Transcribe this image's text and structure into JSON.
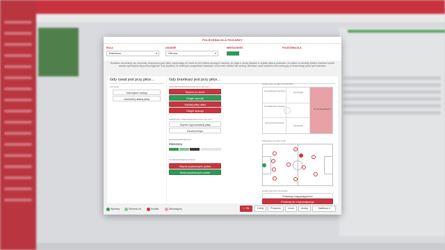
{
  "dialog": {
    "title": "POLECENIA DLA PIŁKARZY",
    "role_label": "ROLA",
    "role_value": "Bramkarz",
    "duty_label": "ZADANIE",
    "duty_value": "Obrona",
    "mentality_label": "MENTALNOŚĆ",
    "potential_label": "POLECENIA DLA",
    "potential_value": "-",
    "description": "Bramkarz koncentruje się na prostej, bezpiecznej grze piłką, zapewniając że bronił do nich wbrew wymogom zamiany, że zagra a obrotu błędami w obrębie piłka-w podwórku. Za udane od otwartej drabiny bramkarz będzie szanse wymknięcia się przed przyjęciem w tej wymiany. W niektórych przypadkach bramkarz, może mieć również bez zmiany. Bramkarz może zarazem mieć udaną grę w koncentracji przed tymi zdaniami.",
    "colors": {
      "red": "#c9353f",
      "green": "#2f9a57",
      "light_green": "#7ec896",
      "light_red": "#e8a1a6"
    }
  },
  "left_panel": {
    "title": "Gdy rywal jest przy piłce...",
    "section_label": "OGÓLNE",
    "options": [
      "Ostrzejsze wślizgi",
      "Ostrożniej atakuj piłkę"
    ]
  },
  "right_panel": {
    "title": "Gdy bramkarz jest przy piłce...",
    "distribution_label": "SPOSÓB WPROWADZANIA PIŁKI DO GRY",
    "distribution_options": [
      "Wyrzuć po ziemi",
      "Długie wyrzuty",
      "Wybijaj piłkę dalej",
      "Długie wykopy"
    ],
    "pace_label": "PRĘDKOŚĆ WPROWADZANIA PIŁKI DO GRY",
    "pace_options": [
      "Szybko wyprowadzaj piłkę",
      "Zwolnij tempo"
    ],
    "distribution_type_label": "WPROWADZANIE PIŁKI",
    "distribution_type_value": "Mieszany",
    "passing_label": "WYPROWADZENIE PODAŃ",
    "passing_options": [
      "Więcej ryzykownych podań",
      "Mniej ryzykownych podań"
    ],
    "zone_label": "ZAGRYWAJ W SEKTOR BOISKA",
    "zone_cells": [
      "Do środkowych obrońców",
      "Na skrzydła",
      "Do środkowych obrońców",
      "Do pół-skrzydłowych",
      "Do bocznych obrońców",
      "Na skrzydła",
      "Za plecy obrońców"
    ],
    "position_label": "PODAWAJ NA POZYCJĘ",
    "player_label": "ZAGRYWAJ DO PIŁKARZA",
    "player_options": [
      "Podawaj rozgrywającemu",
      "Podawaj do rozgrywającego"
    ]
  },
  "footer": {
    "legend": [
      "Wybrany",
      "Element roli",
      "Konflikt",
      "Niedostępny"
    ],
    "buttons": {
      "ok": "Ok",
      "back": "Cofnij",
      "reset": "Przywróć",
      "remove": "Usuń",
      "cancel": "Anuluj",
      "templates": "Szablony"
    }
  }
}
